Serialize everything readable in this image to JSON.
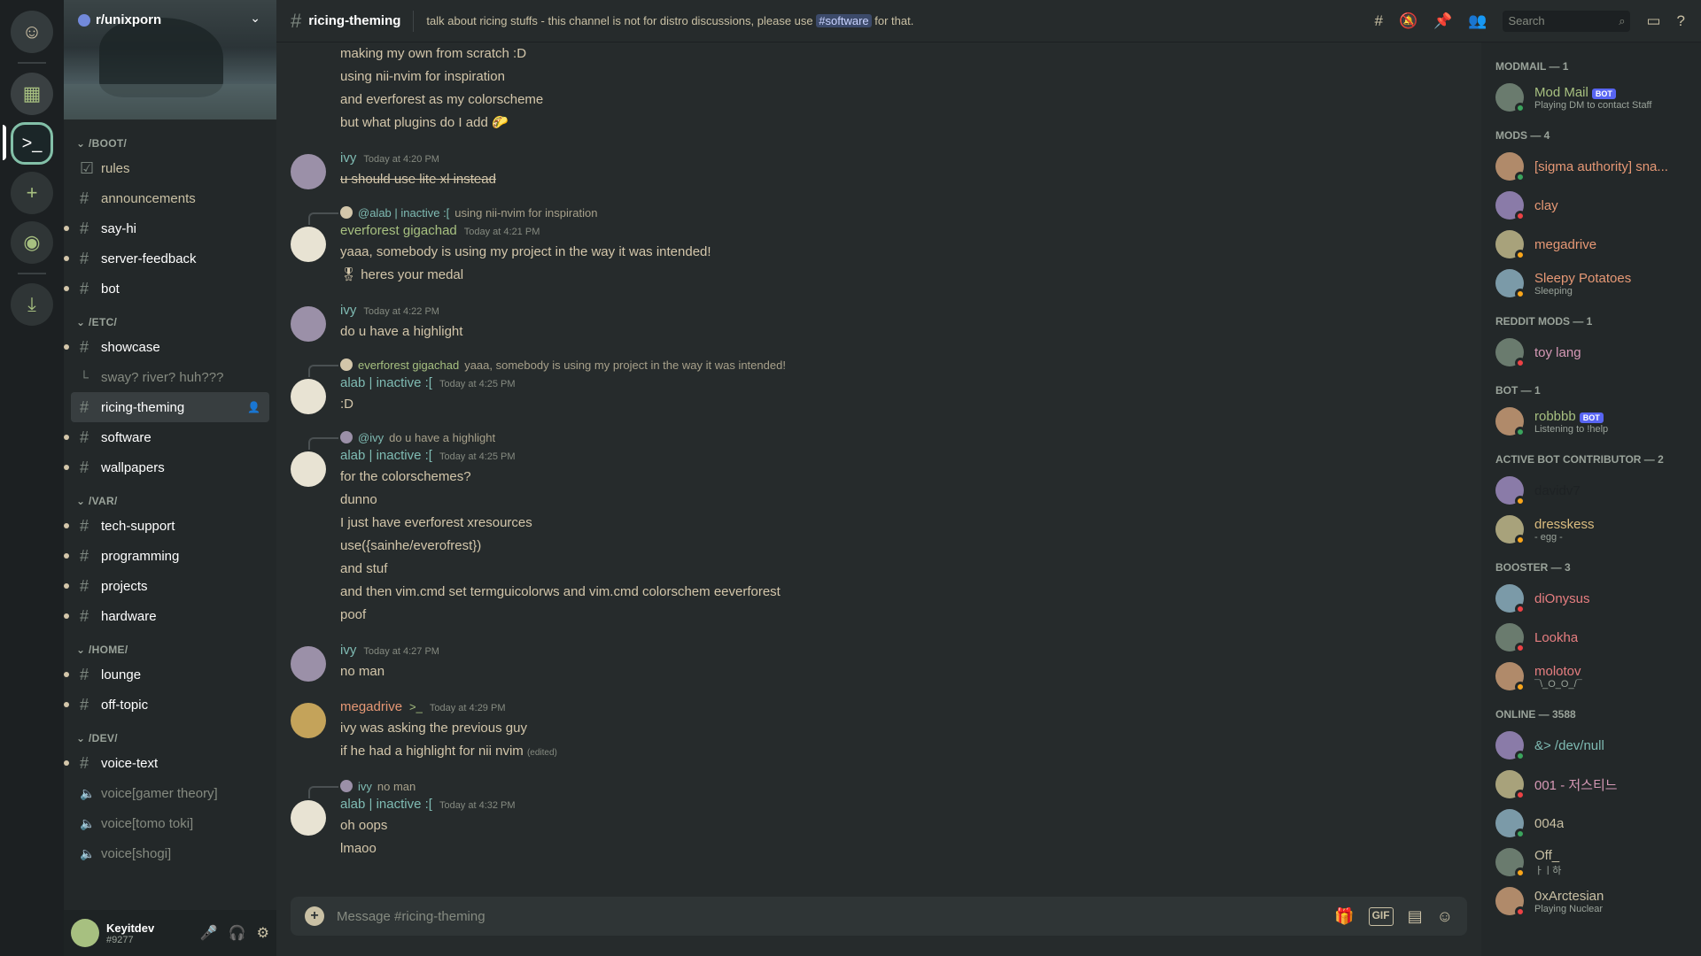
{
  "rail": {
    "home_icon": "discord-icon",
    "servers": [
      "server-1",
      "r/unixporn"
    ],
    "add_label": "+",
    "explore_icon": "compass-icon",
    "download_icon": "download-icon"
  },
  "server": {
    "name": "r/unixporn"
  },
  "categories": [
    {
      "name": "/BOOT/",
      "channels": [
        {
          "name": "rules",
          "type": "rules"
        },
        {
          "name": "announcements",
          "type": "text"
        },
        {
          "name": "say-hi",
          "type": "text",
          "unread": true
        },
        {
          "name": "server-feedback",
          "type": "text",
          "unread": true
        },
        {
          "name": "bot",
          "type": "text",
          "unread": true
        }
      ]
    },
    {
      "name": "/ETC/",
      "channels": [
        {
          "name": "showcase",
          "type": "text",
          "unread": true
        },
        {
          "name": "sway? river? huh???",
          "type": "thread"
        },
        {
          "name": "ricing-theming",
          "type": "text",
          "selected": true
        },
        {
          "name": "software",
          "type": "text",
          "unread": true
        },
        {
          "name": "wallpapers",
          "type": "text",
          "unread": true
        }
      ]
    },
    {
      "name": "/VAR/",
      "channels": [
        {
          "name": "tech-support",
          "type": "text",
          "unread": true
        },
        {
          "name": "programming",
          "type": "text",
          "unread": true
        },
        {
          "name": "projects",
          "type": "text",
          "unread": true
        },
        {
          "name": "hardware",
          "type": "text",
          "unread": true
        }
      ]
    },
    {
      "name": "/HOME/",
      "channels": [
        {
          "name": "lounge",
          "type": "text",
          "unread": true
        },
        {
          "name": "off-topic",
          "type": "text",
          "unread": true
        }
      ]
    },
    {
      "name": "/DEV/",
      "channels": [
        {
          "name": "voice-text",
          "type": "text",
          "unread": true
        },
        {
          "name": "voice[gamer theory]",
          "type": "voice"
        },
        {
          "name": "voice[tomo toki]",
          "type": "voice"
        },
        {
          "name": "voice[shogi]",
          "type": "voice"
        }
      ]
    }
  ],
  "user": {
    "name": "Keyitdev",
    "tag": "#9277"
  },
  "header": {
    "channel": "ricing-theming",
    "topic_before": "talk about ricing stuffs - this channel is not for distro discussions, please use",
    "topic_mention": "#software",
    "topic_after": "for that.",
    "search_placeholder": "Search"
  },
  "messages": {
    "top_lines": [
      "making my own from scratch :D",
      "using nii-nvim for inspiration",
      "and everforest as my colorscheme",
      "but what plugins do I add 🌮"
    ],
    "m1": {
      "author": "ivy",
      "time": "Today at 4:20 PM",
      "lines": [
        "u should use lite xl instead"
      ]
    },
    "r2": {
      "name": "@alab | inactive :[",
      "text": "using nii-nvim for inspiration"
    },
    "m2": {
      "author": "everforest gigachad",
      "time": "Today at 4:21 PM",
      "lines": [
        "yaaa, somebody is using my project in the way it was intended!",
        "🎖 heres your medal"
      ]
    },
    "m3": {
      "author": "ivy",
      "time": "Today at 4:22 PM",
      "lines": [
        "do u have a highlight"
      ]
    },
    "r4": {
      "name": "everforest gigachad",
      "text": "yaaa, somebody is using my project in the way it was intended!"
    },
    "m4": {
      "author": "alab | inactive :[",
      "time": "Today at 4:25 PM",
      "lines": [
        ":D"
      ]
    },
    "r5": {
      "name": "@ivy",
      "text": "do u have a highlight"
    },
    "m5": {
      "author": "alab | inactive :[",
      "time": "Today at 4:25 PM",
      "lines": [
        "for the colorschemes?",
        "dunno",
        "I just have everforest xresources",
        "use({sainhe/everofrest})",
        "and stuf",
        "and then vim.cmd set termguicolorws and vim.cmd colorschem eeverforest",
        "poof"
      ]
    },
    "m6": {
      "author": "ivy",
      "time": "Today at 4:27 PM",
      "lines": [
        "no man"
      ]
    },
    "m7": {
      "author": "megadrive",
      "time": "Today at 4:29 PM",
      "lines": [
        "ivy was asking the previous guy",
        "if he had a highlight for nii nvim"
      ],
      "edited": "(edited)"
    },
    "r8": {
      "name": "ivy",
      "text": "no man"
    },
    "m8": {
      "author": "alab | inactive :[",
      "time": "Today at 4:32 PM",
      "lines": [
        "oh oops",
        "lmaoo"
      ]
    }
  },
  "composer": {
    "placeholder": "Message #ricing-theming",
    "gif": "GIF"
  },
  "members": {
    "groups": [
      {
        "title": "MODMAIL — 1",
        "members": [
          {
            "name": "Mod Mail",
            "bot": "BOT",
            "sub": "Playing DM to contact Staff",
            "color": "#a7c080",
            "status": "#3ba55d"
          }
        ]
      },
      {
        "title": "MODS — 4",
        "members": [
          {
            "name": "[sigma authority] sna...",
            "color": "#e69875",
            "status": "#3ba55d"
          },
          {
            "name": "clay",
            "color": "#e69875",
            "status": "#ed4245"
          },
          {
            "name": "megadrive",
            "color": "#e69875",
            "status": "#faa61a"
          },
          {
            "name": "Sleepy Potatoes",
            "sub": "Sleeping",
            "color": "#e69875",
            "status": "#faa61a"
          }
        ]
      },
      {
        "title": "REDDIT MODS — 1",
        "members": [
          {
            "name": "toy lang",
            "color": "#d699b6",
            "status": "#ed4245"
          }
        ]
      },
      {
        "title": "BOT — 1",
        "members": [
          {
            "name": "robbbb",
            "bot": "BOT",
            "sub": "Listening to !help",
            "color": "#a7c080",
            "status": "#3ba55d"
          }
        ]
      },
      {
        "title": "ACTIVE BOT CONTRIBUTOR — 2",
        "members": [
          {
            "name": "davidv7",
            "color": "#1e2224",
            "status": "#faa61a"
          },
          {
            "name": "dresskess",
            "sub": "- egg -",
            "color": "#dbbc7f",
            "status": "#faa61a"
          }
        ]
      },
      {
        "title": "BOOSTER — 3",
        "members": [
          {
            "name": "diOnysus",
            "color": "#e67e80",
            "status": "#ed4245"
          },
          {
            "name": "Lookha",
            "color": "#e67e80",
            "status": "#ed4245"
          },
          {
            "name": "molotov",
            "sub": "¯\\_O_O_/¯",
            "color": "#e67e80",
            "status": "#faa61a"
          }
        ]
      },
      {
        "title": "ONLINE — 3588",
        "members": [
          {
            "name": "&> /dev/null",
            "color": "#7fbbb3",
            "status": "#3ba55d"
          },
          {
            "name": "001 - 저스티느",
            "color": "#d699b6",
            "status": "#ed4245"
          },
          {
            "name": "004a",
            "color": "#c9c0a4",
            "status": "#3ba55d"
          },
          {
            "name": "Off_",
            "sub": "ㅏㅣ하",
            "color": "#c9c0a4",
            "status": "#faa61a"
          },
          {
            "name": "0xArctesian",
            "sub": "Playing Nuclear",
            "color": "#c9c0a4",
            "status": "#ed4245"
          }
        ]
      }
    ]
  }
}
